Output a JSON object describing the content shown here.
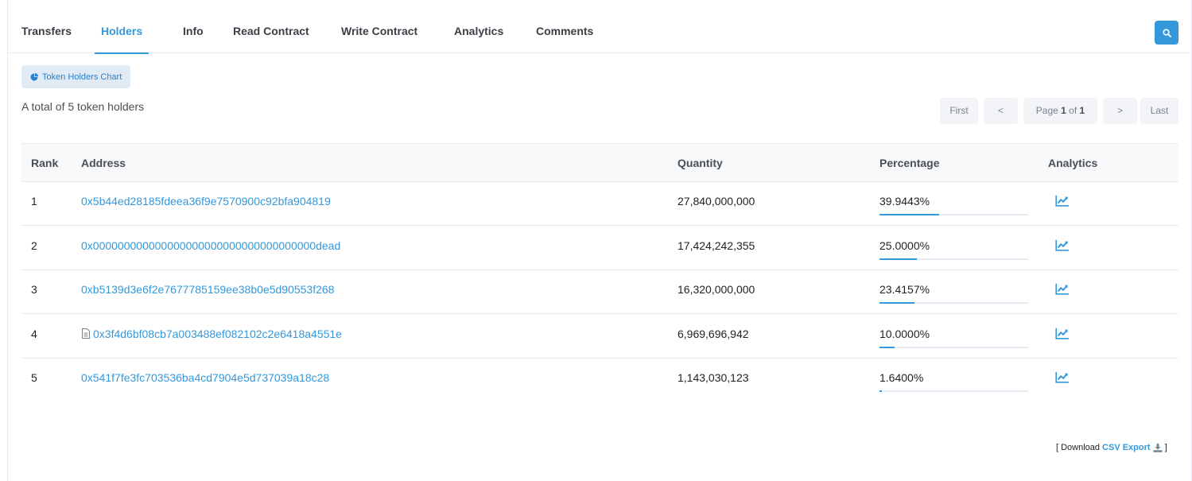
{
  "tabs": [
    {
      "label": "Transfers",
      "active": false
    },
    {
      "label": "Holders",
      "active": true
    },
    {
      "label": "Info",
      "active": false
    },
    {
      "label": "Read Contract",
      "active": false
    },
    {
      "label": "Write Contract",
      "active": false
    },
    {
      "label": "Analytics",
      "active": false
    },
    {
      "label": "Comments",
      "active": false
    }
  ],
  "chart_button": {
    "label": "Token Holders Chart",
    "icon": "pie-chart-icon"
  },
  "summary": "A total of 5 token holders",
  "pagination": {
    "first": "First",
    "prev": "<",
    "page_prefix": "Page",
    "page_current": "1",
    "page_of": "of",
    "page_total": "1",
    "next": ">",
    "last": "Last"
  },
  "table": {
    "headers": {
      "rank": "Rank",
      "address": "Address",
      "quantity": "Quantity",
      "percentage": "Percentage",
      "analytics": "Analytics"
    },
    "rows": [
      {
        "rank": "1",
        "address": "0x5b44ed28185fdeea36f9e7570900c92bfa904819",
        "is_contract": false,
        "quantity": "27,840,000,000",
        "percentage": "39.9443%",
        "pct_value": 39.9443
      },
      {
        "rank": "2",
        "address": "0x000000000000000000000000000000000000dead",
        "is_contract": false,
        "quantity": "17,424,242,355",
        "percentage": "25.0000%",
        "pct_value": 25.0
      },
      {
        "rank": "3",
        "address": "0xb5139d3e6f2e7677785159ee38b0e5d90553f268",
        "is_contract": false,
        "quantity": "16,320,000,000",
        "percentage": "23.4157%",
        "pct_value": 23.4157
      },
      {
        "rank": "4",
        "address": "0x3f4d6bf08cb7a003488ef082102c2e6418a4551e",
        "is_contract": true,
        "quantity": "6,969,696,942",
        "percentage": "10.0000%",
        "pct_value": 10.0
      },
      {
        "rank": "5",
        "address": "0x541f7fe3fc703536ba4cd7904e5d737039a18c28",
        "is_contract": false,
        "quantity": "1,143,030,123",
        "percentage": "1.6400%",
        "pct_value": 1.64
      }
    ]
  },
  "download": {
    "prefix": "[ Download",
    "link": "CSV Export",
    "suffix": "]"
  },
  "colors": {
    "accent": "#3498db",
    "header_bg": "#f8f9fa",
    "border": "#e7eaf3"
  }
}
